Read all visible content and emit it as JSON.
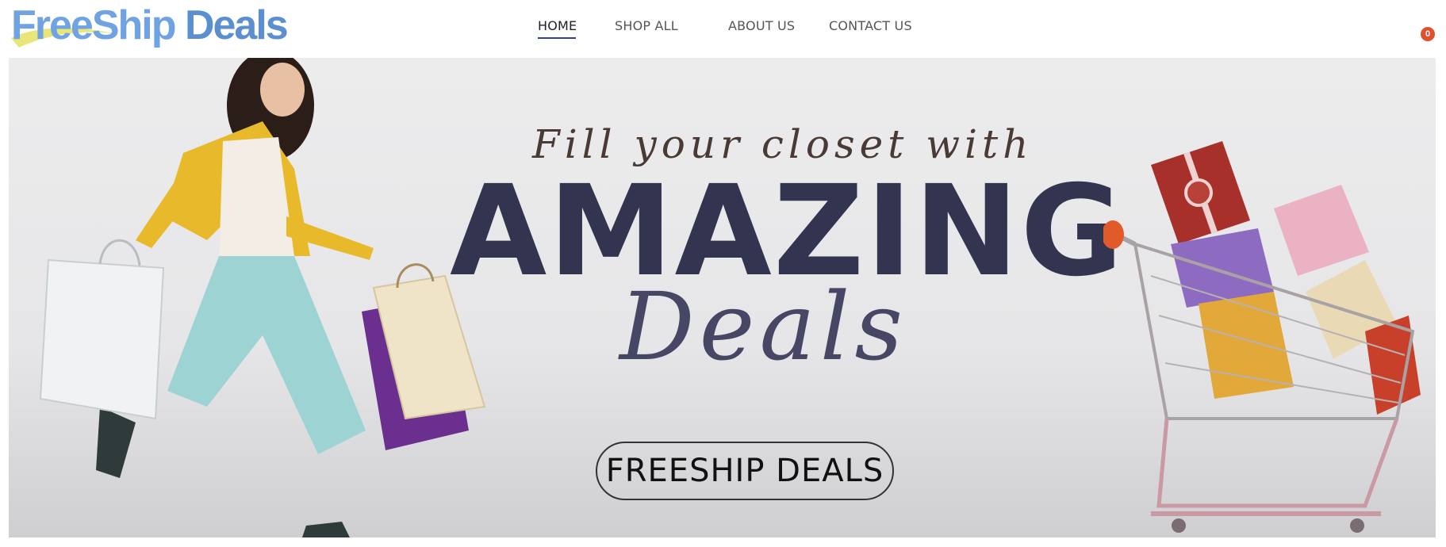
{
  "brand": {
    "logo_part1": "FreeShip",
    "logo_part2": " Deals"
  },
  "nav": {
    "items": [
      {
        "label": "HOME",
        "active": true
      },
      {
        "label": "SHOP ALL",
        "active": false
      },
      {
        "label": "ABOUT US",
        "active": false
      },
      {
        "label": "CONTACT US",
        "active": false
      }
    ]
  },
  "cart": {
    "count": "0",
    "icon": "cart-icon"
  },
  "hero": {
    "tagline": "Fill your closet with",
    "headline": "AMAZING",
    "script": "Deals",
    "cta": "FREESHIP DEALS"
  },
  "colors": {
    "brand_blue": "#5b8fd0",
    "swoosh_yellow": "#e6e36a",
    "nav_underline": "#2e3fa8",
    "headline": "#333450",
    "badge": "#e0522e"
  }
}
